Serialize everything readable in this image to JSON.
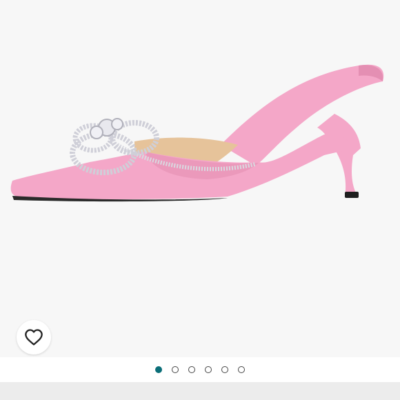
{
  "gallery": {
    "image": "pink-satin-crystal-bow-mule-icon",
    "colors": {
      "background": "#f7f7f7",
      "shoe": "#f4a7c8",
      "shoe_shade": "#e48fb3",
      "lining": "#e6c39a",
      "crystal": "#d9d9e0"
    }
  },
  "like_button": {
    "icon": "heart-outline-icon"
  },
  "pager": {
    "count": 6,
    "active_index": 0,
    "active_color": "#0b6e78"
  }
}
